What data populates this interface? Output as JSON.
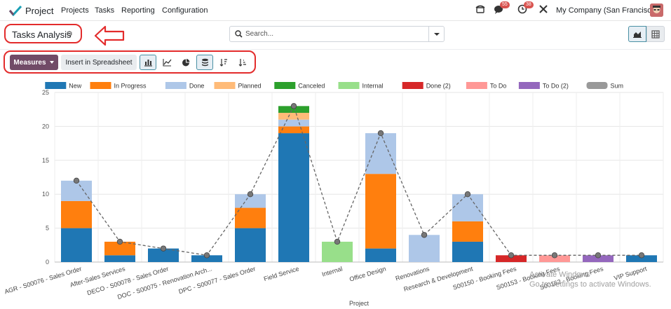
{
  "navbar": {
    "app_name": "Project",
    "menus": [
      "Projects",
      "Tasks",
      "Reporting",
      "Configuration"
    ],
    "messages_badge": "55",
    "activities_badge": "38",
    "company": "My Company (San Francisco)",
    "icons": [
      "app-logo-icon",
      "phone-icon",
      "messages-icon",
      "activities-icon",
      "tools-icon",
      "avatar"
    ]
  },
  "control_panel": {
    "title": "Tasks Analysis",
    "search_placeholder": "Search...",
    "buttons": {
      "measures": "Measures",
      "insert": "Insert in Spreadsheet"
    }
  },
  "watermark": {
    "line1": "Activate Windows",
    "line2": "Go to Settings to activate Windows."
  },
  "chart_data": {
    "type": "bar",
    "stacked": true,
    "xlabel": "Project",
    "ylabel": "",
    "ylim": [
      0,
      25
    ],
    "yticks": [
      0,
      5,
      10,
      15,
      20,
      25
    ],
    "grid": true,
    "legend_position": "top",
    "categories": [
      "AGR - S00076 - Sales Order",
      "After-Sales Services",
      "DECO - S00078 - Sales Order",
      "DOC - S00075 - Renovation Arch...",
      "DPC - S00077 - Sales Order",
      "Field Service",
      "Internal",
      "Office Design",
      "Renovations",
      "Research & Development",
      "S00150 - Booking Fees",
      "S00153 - Booking Fees",
      "S00162 - Booking Fees",
      "VIP Support"
    ],
    "series": [
      {
        "name": "New",
        "color": "#1f77b4",
        "values": [
          5,
          1,
          2,
          1,
          5,
          19,
          0,
          2,
          0,
          3,
          0,
          0,
          0,
          1
        ]
      },
      {
        "name": "In Progress",
        "color": "#ff7f0e",
        "values": [
          4,
          2,
          0,
          0,
          3,
          1,
          0,
          11,
          0,
          3,
          0,
          0,
          0,
          0
        ]
      },
      {
        "name": "Done",
        "color": "#aec7e8",
        "values": [
          3,
          0,
          0,
          0,
          2,
          1,
          0,
          6,
          4,
          4,
          0,
          0,
          0,
          0
        ]
      },
      {
        "name": "Planned",
        "color": "#ffbb78",
        "values": [
          0,
          0,
          0,
          0,
          0,
          1,
          0,
          0,
          0,
          0,
          0,
          0,
          0,
          0
        ]
      },
      {
        "name": "Canceled",
        "color": "#2ca02c",
        "values": [
          0,
          0,
          0,
          0,
          0,
          1,
          0,
          0,
          0,
          0,
          0,
          0,
          0,
          0
        ]
      },
      {
        "name": "Internal",
        "color": "#98df8a",
        "values": [
          0,
          0,
          0,
          0,
          0,
          0,
          3,
          0,
          0,
          0,
          0,
          0,
          0,
          0
        ]
      },
      {
        "name": "Done (2)",
        "color": "#d62728",
        "values": [
          0,
          0,
          0,
          0,
          0,
          0,
          0,
          0,
          0,
          0,
          1,
          0,
          0,
          0
        ]
      },
      {
        "name": "To Do",
        "color": "#ff9896",
        "values": [
          0,
          0,
          0,
          0,
          0,
          0,
          0,
          0,
          0,
          0,
          0,
          1,
          0,
          0
        ]
      },
      {
        "name": "To Do (2)",
        "color": "#9467bd",
        "values": [
          0,
          0,
          0,
          0,
          0,
          0,
          0,
          0,
          0,
          0,
          0,
          0,
          1,
          0
        ]
      }
    ],
    "sum_series": {
      "name": "Sum",
      "color": "#555555",
      "values": [
        12,
        3,
        2,
        1,
        10,
        23,
        3,
        19,
        4,
        10,
        1,
        1,
        1,
        1
      ]
    }
  }
}
